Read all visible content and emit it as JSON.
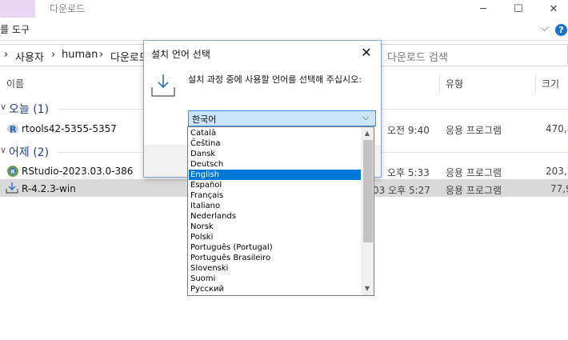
{
  "window": {
    "title": "다운로드",
    "controls": [
      "─",
      "☐",
      "✕"
    ]
  },
  "ribbon": {
    "tab_label": "를 도구",
    "help": "?"
  },
  "address": {
    "crumbs": [
      "›",
      "사용자",
      "›",
      "human",
      "›",
      "다운로드"
    ],
    "search_placeholder": "다운로드 검색"
  },
  "columns": {
    "name": "이름",
    "date": "",
    "type": "유형",
    "size": "크기"
  },
  "groups": [
    {
      "label": "오늘 (1)",
      "files": [
        {
          "name": "rtools42-5355-5357",
          "date": "오전 9:40",
          "type": "응용 프로그램",
          "size": "470,8"
        }
      ]
    },
    {
      "label": "어제 (2)",
      "files": [
        {
          "name": "RStudio-2023.03.0-386",
          "date": "오후 5:33",
          "type": "응용 프로그램",
          "size": "203,2"
        },
        {
          "name": "R-4.2.3-win",
          "date": "03 오후 5:27",
          "type": "응용 프로그램",
          "size": "77,9"
        }
      ]
    }
  ],
  "dialog": {
    "title": "설치 언어 선택",
    "close": "✕",
    "message": "설치 과정 중에 사용할 언어를 선택해 주십시오:",
    "selected_language": "한국어",
    "combo_arrow": "⌵",
    "languages": [
      "Català",
      "Čeština",
      "Dansk",
      "Deutsch",
      "English",
      "Español",
      "Français",
      "Italiano",
      "Nederlands",
      "Norsk",
      "Polski",
      "Português (Portugal)",
      "Português Brasileiro",
      "Slovenski",
      "Suomi",
      "Русский"
    ],
    "highlighted_index": 4
  },
  "colors": {
    "accent": "#0078d7",
    "group_heading": "#1f3f8a",
    "selected_row": "#d9d9d9"
  }
}
